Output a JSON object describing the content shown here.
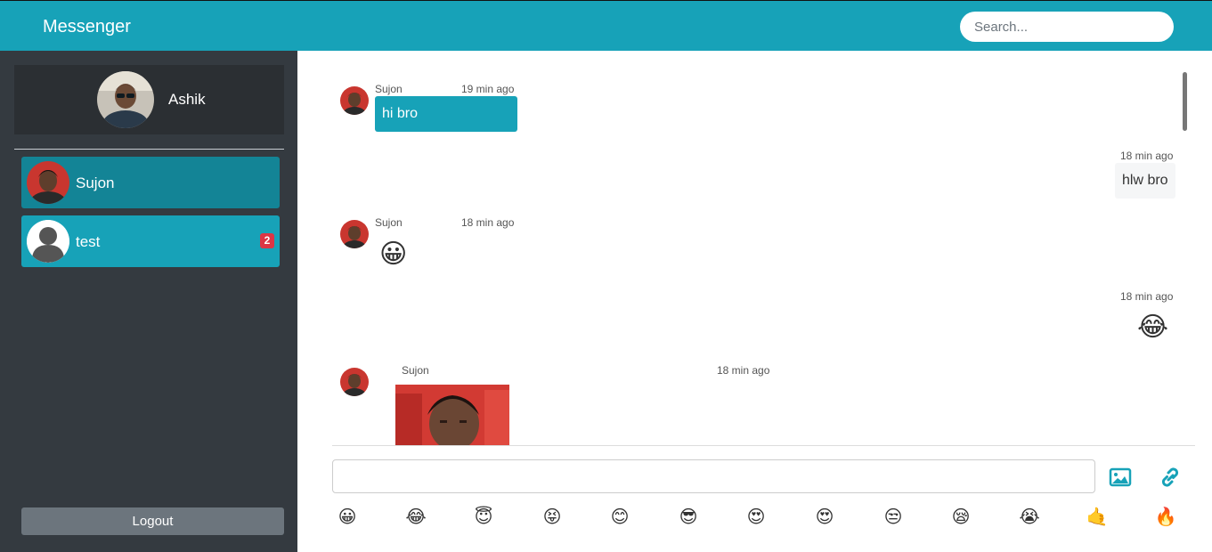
{
  "header": {
    "brand": "Messenger",
    "search_placeholder": "Search..."
  },
  "sidebar": {
    "profile": {
      "name": "Ashik"
    },
    "contacts": [
      {
        "name": "Sujon",
        "active": true,
        "unread": ""
      },
      {
        "name": "test",
        "active": false,
        "unread": "2"
      }
    ],
    "logout_label": "Logout"
  },
  "chat": {
    "messages": [
      {
        "direction": "in",
        "sender": "Sujon",
        "time": "19 min ago",
        "text": "hi bro",
        "kind": "text"
      },
      {
        "direction": "out",
        "sender": "",
        "time": "18 min ago",
        "text": "hlw bro",
        "kind": "text"
      },
      {
        "direction": "in",
        "sender": "Sujon",
        "time": "18 min ago",
        "text": "😀",
        "kind": "emoji"
      },
      {
        "direction": "out",
        "sender": "",
        "time": "18 min ago",
        "text": "😂",
        "kind": "emoji"
      },
      {
        "direction": "in",
        "sender": "Sujon",
        "time": "18 min ago",
        "text": "",
        "kind": "image"
      }
    ],
    "input_placeholder": "",
    "tools": [
      "image-icon",
      "link-icon"
    ],
    "emoji_palette": [
      "😀",
      "😂",
      "😇",
      "😝",
      "😊",
      "😎",
      "😍",
      "😍",
      "😒",
      "😪",
      "😭",
      "🤙",
      "🔥"
    ]
  },
  "colors": {
    "brand": "#17a2b8",
    "brand_dark": "#138496",
    "sidebar": "#343a40",
    "badge": "#dc3545",
    "logout": "#6c757d"
  }
}
